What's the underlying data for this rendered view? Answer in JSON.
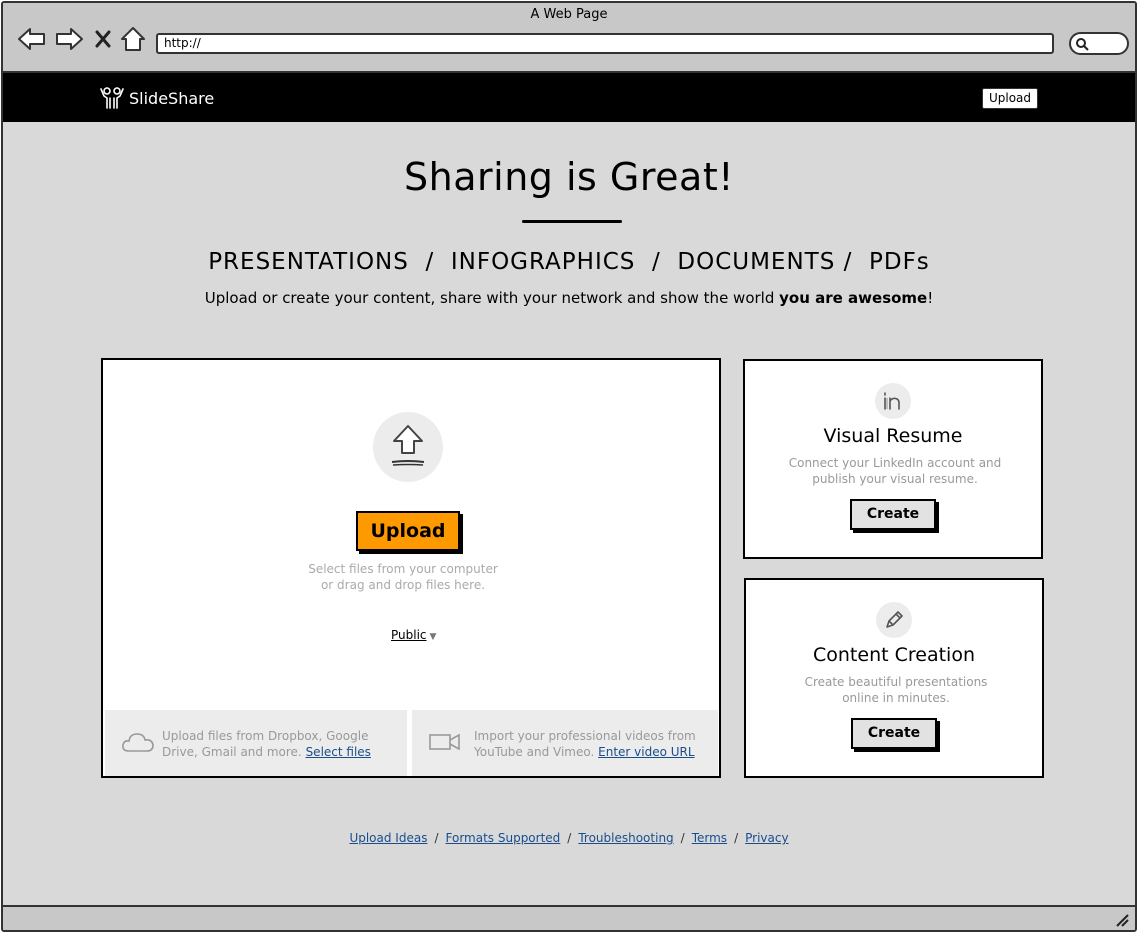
{
  "window": {
    "title": "A Web Page"
  },
  "browser": {
    "url": "http://"
  },
  "header": {
    "logo_text": "SlideShare",
    "upload_label": "Upload"
  },
  "hero": {
    "headline": "Sharing is Great!",
    "types": "PRESENTATIONS  /  INFOGRAPHICS  /  DOCUMENTS /  PDFs",
    "tagline_prefix": "Upload or create your content, share with your network and show the world ",
    "tagline_bold": "you are awesome",
    "tagline_suffix": "!"
  },
  "upload_panel": {
    "upload_label": "Upload",
    "hint_line1": "Select files from your computer",
    "hint_line2": "or drag and drop files here.",
    "privacy_value": "Public",
    "cloud_text": "Upload files from Dropbox, Google Drive, Gmail and more. ",
    "cloud_link": "Select files",
    "video_text": "Import your professional videos from YouTube and Vimeo. ",
    "video_link": "Enter video URL"
  },
  "cards": [
    {
      "icon": "linkedin-icon",
      "title": "Visual Resume",
      "description": "Connect your LinkedIn account and publish your visual resume.",
      "button": "Create"
    },
    {
      "icon": "pencil-icon",
      "title": "Content Creation",
      "description": "Create beautiful presentations online in minutes.",
      "button": "Create"
    }
  ],
  "footer": {
    "links": [
      "Upload Ideas",
      "Formats Supported",
      "Troubleshooting",
      "Terms",
      "Privacy"
    ],
    "separator": "/"
  },
  "colors": {
    "accent": "#ff9900",
    "link": "#1a4d8c",
    "topbar": "#000000",
    "page_bg": "#d9d9d9"
  }
}
